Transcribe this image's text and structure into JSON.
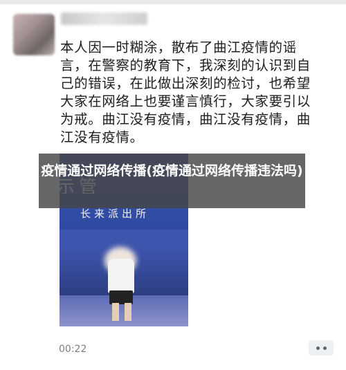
{
  "post": {
    "text": "本人因一时糊涂，散布了曲江疫情的谣言，在警察的教育下，我深刻的认识到自己的错误，在此做出深刻的检讨，也希望大家在网络上也要谨言慎行，大家要引以为戒。曲江没有疫情，曲江没有疫情，曲江没有疫情。",
    "timestamp": "00:22"
  },
  "photo": {
    "sign_partial": "示管",
    "sign_text": "长来派出所"
  },
  "overlay": {
    "title": "疫情通过网络传播(疫情通过网络传播违法吗)"
  },
  "icons": {
    "avatar": "user-avatar",
    "more": "more-dots-icon"
  }
}
